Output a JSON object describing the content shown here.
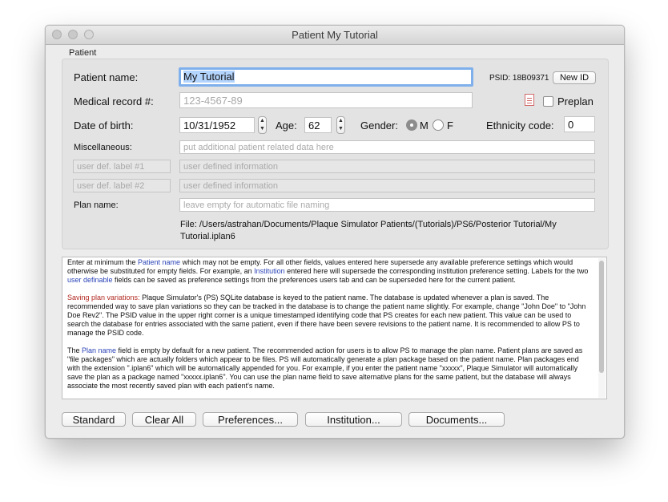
{
  "window": {
    "title": "Patient My Tutorial"
  },
  "group": {
    "title": "Patient"
  },
  "patient_name": {
    "label": "Patient name:",
    "value": "My Tutorial"
  },
  "psid": {
    "text": "PSID: 18B09371",
    "new_id_label": "New ID"
  },
  "medical_record": {
    "label": "Medical record #:",
    "placeholder": "123-4567-89"
  },
  "preplan": {
    "label": "Preplan",
    "checked": false
  },
  "dob": {
    "label": "Date of birth:",
    "value": "10/31/1952"
  },
  "age": {
    "label": "Age:",
    "value": "62"
  },
  "gender": {
    "label": "Gender:",
    "options": [
      "M",
      "F"
    ],
    "selected": "M"
  },
  "ethnicity": {
    "label": "Ethnicity code:",
    "value": "0"
  },
  "misc": {
    "label": "Miscellaneous:",
    "placeholder": "put additional patient related data here"
  },
  "user_def": [
    {
      "label_placeholder": "user def. label #1",
      "info_placeholder": "user defined information"
    },
    {
      "label_placeholder": "user def. label #2",
      "info_placeholder": "user defined information"
    }
  ],
  "plan_name": {
    "label": "Plan name:",
    "placeholder": "leave empty for automatic file naming"
  },
  "file": {
    "text": "File: /Users/astrahan/Documents/Plaque Simulator Patients/(Tutorials)/PS6/Posterior Tutorial/My Tutorial.iplan6"
  },
  "help": {
    "p1": [
      "Enter at minimum the ",
      "Patient name",
      " which may not be empty. For all other fields, values entered here supersede any available preference settings which would otherwise be substituted for empty fields. For example, an ",
      "Institution",
      " entered here will supersede the corresponding institution preference setting. Labels for the two ",
      "user definable",
      " fields can be saved as preference settings from the preferences users tab and can be superseded here for the current patient."
    ],
    "p2": [
      "Saving plan variations:",
      " Plaque Simulator's (PS) SQLite database is keyed to the patient name. The database is updated whenever a plan is saved. The recommended way to save plan variations so they can be tracked in the database is to change the patient name slightly. For example, change \"John Doe\" to \"John Doe Rev2\". The PSID value in the upper right corner is a unique timestamped identifying code that PS creates for each new patient. This value can be used to search the database for entries associated with the same patient, even if there have been severe revisions to the patient name. It is recommended to allow PS to manage the PSID code."
    ],
    "p3": [
      "The ",
      "Plan name",
      " field is empty by default for a new patient. The recommended action for users is to allow PS to manage the plan name.  Patient plans are saved as \"file packages\" which are actually folders which appear to be files. PS will automatically generate a plan package based on the patient name. Plan packages end with the extension \".iplan6\" which will be automatically appended for you. For example, if you enter the patient name \"xxxxx\", Plaque Simulator will automatically save the plan as a package named \"xxxxx.iplan6\". You can use the plan name field to save alternative plans for the same patient, but the database will always associate the most recently saved plan with each patient's name."
    ]
  },
  "buttons": {
    "standard": "Standard",
    "clear_all": "Clear All",
    "preferences": "Preferences...",
    "institution": "Institution...",
    "documents": "Documents..."
  },
  "colors": {
    "focus_ring": "#7fb0ec",
    "link_blue": "#2a43b7",
    "warning_red": "#b22a22"
  }
}
